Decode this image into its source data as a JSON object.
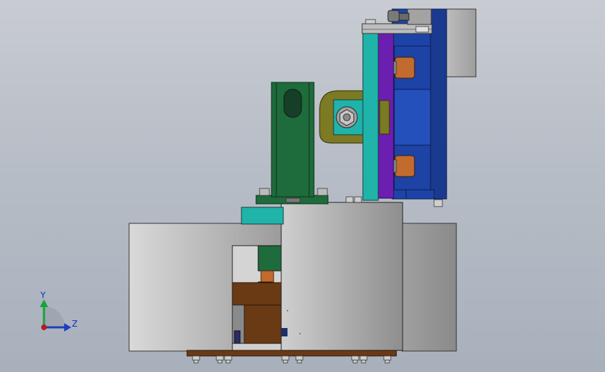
{
  "view": {
    "axes_triad": {
      "x_label": "",
      "y_label": "Y",
      "z_label": "Z"
    }
  },
  "colors": {
    "background_top": "#c8ccd2",
    "background_bottom": "#a8b0bc",
    "steel_grey": "#a9a9a9",
    "bronze_base": "#6a3a15",
    "teal_plate": "#1fb3aa",
    "blue_housing": "#1d43a6",
    "purple_plate": "#6b1fb1",
    "green_cylinder": "#1e6b3c",
    "olive_clevis": "#7c7a22",
    "copper": "#c26b2f"
  }
}
